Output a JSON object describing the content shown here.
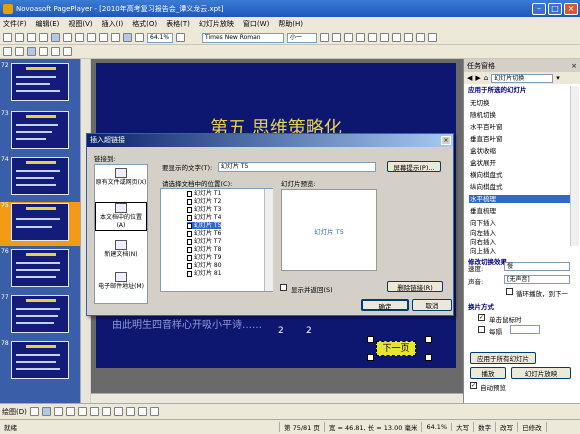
{
  "window": {
    "title": "Novoasoft PagePlayer - [2010年高考复习报告会_谭义龙云.xpt]"
  },
  "menu": [
    "文件(F)",
    "编辑(E)",
    "视图(V)",
    "插入(I)",
    "格式(O)",
    "表格(T)",
    "幻灯片放映",
    "窗口(W)",
    "帮助(H)"
  ],
  "toolbar": {
    "zoom": "64.1%",
    "font": "Times New Roman",
    "size": "小一"
  },
  "slide": {
    "title": "第五  思维策略化",
    "bottom_text": "由此明生四音样心开吸小平诗……",
    "numbers": [
      "2",
      "2"
    ],
    "next_button": "下一页"
  },
  "dialog": {
    "title": "插入超链接",
    "link_to_label": "链接到:",
    "link_items": [
      "原有文件或网页(X)",
      "本文档中的位置(A)",
      "新建文档(N)",
      "电子邮件地址(M)"
    ],
    "display_label": "要显示的文字(T):",
    "display_value": "幻灯片 T5",
    "screen_tip": "屏幕提示(P)...",
    "place_label": "请选择文档中的位置(C):",
    "preview_label": "幻灯片预览:",
    "tree_items": [
      "幻灯片 T1",
      "幻灯片 T2",
      "幻灯片 T3",
      "幻灯片 T4",
      "幻灯片 T5",
      "幻灯片 T6",
      "幻灯片 T7",
      "幻灯片 T8",
      "幻灯片 T9",
      "幻灯片 80",
      "幻灯片 81"
    ],
    "preview_text": "幻灯片 T5",
    "show_return": "显示并返回(S)",
    "remove_link": "删除链接(R)",
    "ok": "确定",
    "cancel": "取消"
  },
  "taskpane": {
    "header": "任务窗格",
    "dropdown": "幻灯片切换",
    "section_title": "应用于所选的幻灯片",
    "items": [
      "无切换",
      "随机切换",
      "水平百叶窗",
      "垂直百叶窗",
      "盒状收缩",
      "盒状展开",
      "横向棋盘式",
      "纵向棋盘式",
      "水平梳理",
      "垂直梳理",
      "向下插入",
      "向左插入",
      "向右插入",
      "向上插入",
      "修改切换效果"
    ],
    "selected_index": 8,
    "speed_label": "速度:",
    "speed_value": "慢",
    "sound_label": "声音:",
    "sound_value": "[无声音]",
    "loop_label": "循环播放，到下一",
    "advance_title": "换片方式",
    "on_click": "单击鼠标时",
    "every": "每隔",
    "apply_all": "应用于所有幻灯片",
    "play": "播放",
    "slideshow": "幻灯片放映",
    "auto_preview": "自动预览"
  },
  "drawbar": {
    "label": "绘图(D)"
  },
  "status": {
    "page": "第 75/81 页",
    "position": "宽 = 46.81, 长 = 13.00 毫米",
    "zoom": "64.1%",
    "caps": "大写",
    "num": "数字",
    "modify": "改写",
    "state": "已修改",
    "ready": "就绪"
  }
}
